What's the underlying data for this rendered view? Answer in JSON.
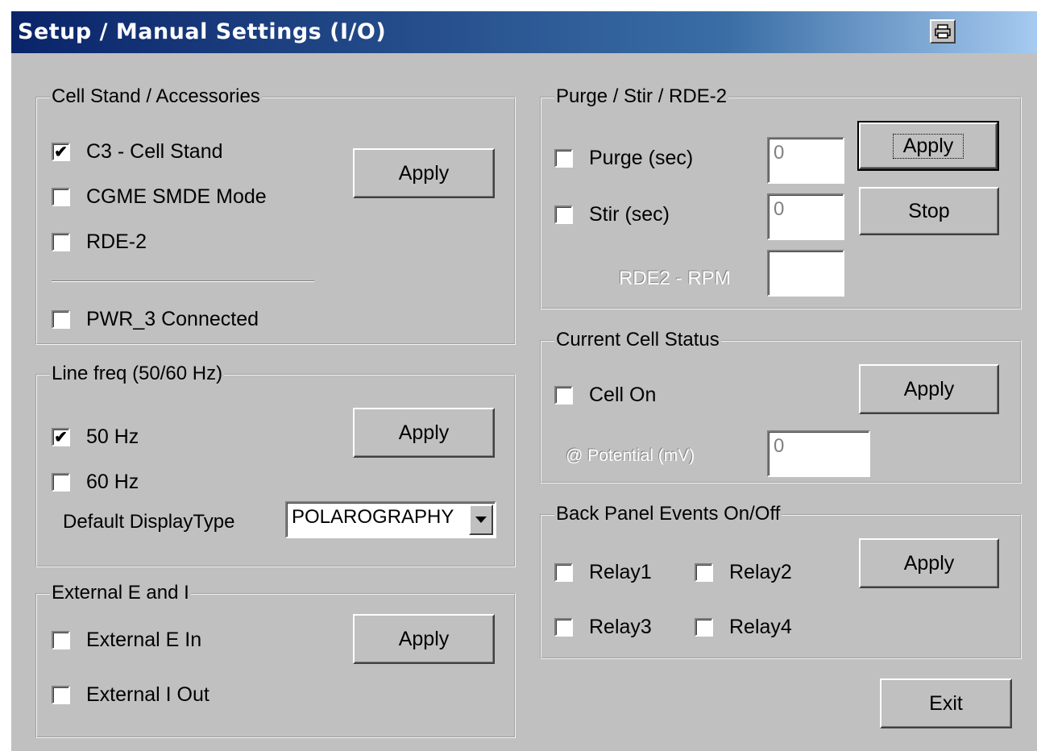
{
  "window": {
    "title": "Setup / Manual Settings (I/O)",
    "print_icon": "printer-icon"
  },
  "cell_stand": {
    "label": "Cell Stand / Accessories",
    "c3": {
      "label": "C3 - Cell Stand",
      "checked": true
    },
    "cgme": {
      "label": "CGME SMDE Mode",
      "checked": false
    },
    "rde2": {
      "label": "RDE-2",
      "checked": false
    },
    "pwr3": {
      "label": "PWR_3 Connected",
      "checked": false
    },
    "apply_label": "Apply"
  },
  "line_freq": {
    "label": "Line freq (50/60 Hz)",
    "hz50": {
      "label": "50 Hz",
      "checked": true
    },
    "hz60": {
      "label": "60 Hz",
      "checked": false
    },
    "apply_label": "Apply",
    "display_type_label": "Default DisplayType",
    "display_type_value": "POLAROGRAPHY"
  },
  "external": {
    "label": "External E and I",
    "e_in": {
      "label": "External E In",
      "checked": false
    },
    "i_out": {
      "label": "External I Out",
      "checked": false
    },
    "apply_label": "Apply"
  },
  "purge_stir": {
    "label": "Purge / Stir / RDE-2",
    "purge": {
      "label": "Purge (sec)",
      "checked": false,
      "value": "0"
    },
    "stir": {
      "label": "Stir (sec)",
      "checked": false,
      "value": "0"
    },
    "rpm": {
      "label": "RDE2 - RPM",
      "value": ""
    },
    "apply_label": "Apply",
    "stop_label": "Stop"
  },
  "cell_status": {
    "label": "Current Cell Status",
    "cell_on": {
      "label": "Cell On",
      "checked": false
    },
    "potential": {
      "label": "@ Potential (mV)",
      "value": "0"
    },
    "apply_label": "Apply"
  },
  "back_panel": {
    "label": "Back Panel Events On/Off",
    "relay1": {
      "label": "Relay1",
      "checked": false
    },
    "relay2": {
      "label": "Relay2",
      "checked": false
    },
    "relay3": {
      "label": "Relay3",
      "checked": false
    },
    "relay4": {
      "label": "Relay4",
      "checked": false
    },
    "apply_label": "Apply"
  },
  "exit_label": "Exit",
  "check_glyph": "✔"
}
